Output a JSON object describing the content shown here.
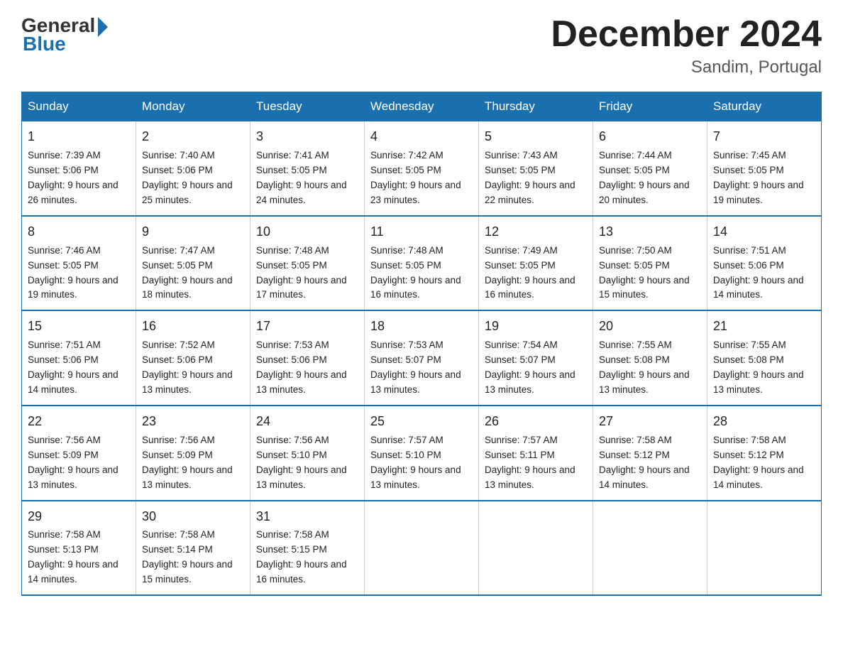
{
  "header": {
    "logo_general": "General",
    "logo_blue": "Blue",
    "month_title": "December 2024",
    "location": "Sandim, Portugal"
  },
  "days_of_week": [
    "Sunday",
    "Monday",
    "Tuesday",
    "Wednesday",
    "Thursday",
    "Friday",
    "Saturday"
  ],
  "weeks": [
    [
      {
        "day": "1",
        "sunrise": "7:39 AM",
        "sunset": "5:06 PM",
        "daylight": "9 hours and 26 minutes."
      },
      {
        "day": "2",
        "sunrise": "7:40 AM",
        "sunset": "5:06 PM",
        "daylight": "9 hours and 25 minutes."
      },
      {
        "day": "3",
        "sunrise": "7:41 AM",
        "sunset": "5:05 PM",
        "daylight": "9 hours and 24 minutes."
      },
      {
        "day": "4",
        "sunrise": "7:42 AM",
        "sunset": "5:05 PM",
        "daylight": "9 hours and 23 minutes."
      },
      {
        "day": "5",
        "sunrise": "7:43 AM",
        "sunset": "5:05 PM",
        "daylight": "9 hours and 22 minutes."
      },
      {
        "day": "6",
        "sunrise": "7:44 AM",
        "sunset": "5:05 PM",
        "daylight": "9 hours and 20 minutes."
      },
      {
        "day": "7",
        "sunrise": "7:45 AM",
        "sunset": "5:05 PM",
        "daylight": "9 hours and 19 minutes."
      }
    ],
    [
      {
        "day": "8",
        "sunrise": "7:46 AM",
        "sunset": "5:05 PM",
        "daylight": "9 hours and 19 minutes."
      },
      {
        "day": "9",
        "sunrise": "7:47 AM",
        "sunset": "5:05 PM",
        "daylight": "9 hours and 18 minutes."
      },
      {
        "day": "10",
        "sunrise": "7:48 AM",
        "sunset": "5:05 PM",
        "daylight": "9 hours and 17 minutes."
      },
      {
        "day": "11",
        "sunrise": "7:48 AM",
        "sunset": "5:05 PM",
        "daylight": "9 hours and 16 minutes."
      },
      {
        "day": "12",
        "sunrise": "7:49 AM",
        "sunset": "5:05 PM",
        "daylight": "9 hours and 16 minutes."
      },
      {
        "day": "13",
        "sunrise": "7:50 AM",
        "sunset": "5:05 PM",
        "daylight": "9 hours and 15 minutes."
      },
      {
        "day": "14",
        "sunrise": "7:51 AM",
        "sunset": "5:06 PM",
        "daylight": "9 hours and 14 minutes."
      }
    ],
    [
      {
        "day": "15",
        "sunrise": "7:51 AM",
        "sunset": "5:06 PM",
        "daylight": "9 hours and 14 minutes."
      },
      {
        "day": "16",
        "sunrise": "7:52 AM",
        "sunset": "5:06 PM",
        "daylight": "9 hours and 13 minutes."
      },
      {
        "day": "17",
        "sunrise": "7:53 AM",
        "sunset": "5:06 PM",
        "daylight": "9 hours and 13 minutes."
      },
      {
        "day": "18",
        "sunrise": "7:53 AM",
        "sunset": "5:07 PM",
        "daylight": "9 hours and 13 minutes."
      },
      {
        "day": "19",
        "sunrise": "7:54 AM",
        "sunset": "5:07 PM",
        "daylight": "9 hours and 13 minutes."
      },
      {
        "day": "20",
        "sunrise": "7:55 AM",
        "sunset": "5:08 PM",
        "daylight": "9 hours and 13 minutes."
      },
      {
        "day": "21",
        "sunrise": "7:55 AM",
        "sunset": "5:08 PM",
        "daylight": "9 hours and 13 minutes."
      }
    ],
    [
      {
        "day": "22",
        "sunrise": "7:56 AM",
        "sunset": "5:09 PM",
        "daylight": "9 hours and 13 minutes."
      },
      {
        "day": "23",
        "sunrise": "7:56 AM",
        "sunset": "5:09 PM",
        "daylight": "9 hours and 13 minutes."
      },
      {
        "day": "24",
        "sunrise": "7:56 AM",
        "sunset": "5:10 PM",
        "daylight": "9 hours and 13 minutes."
      },
      {
        "day": "25",
        "sunrise": "7:57 AM",
        "sunset": "5:10 PM",
        "daylight": "9 hours and 13 minutes."
      },
      {
        "day": "26",
        "sunrise": "7:57 AM",
        "sunset": "5:11 PM",
        "daylight": "9 hours and 13 minutes."
      },
      {
        "day": "27",
        "sunrise": "7:58 AM",
        "sunset": "5:12 PM",
        "daylight": "9 hours and 14 minutes."
      },
      {
        "day": "28",
        "sunrise": "7:58 AM",
        "sunset": "5:12 PM",
        "daylight": "9 hours and 14 minutes."
      }
    ],
    [
      {
        "day": "29",
        "sunrise": "7:58 AM",
        "sunset": "5:13 PM",
        "daylight": "9 hours and 14 minutes."
      },
      {
        "day": "30",
        "sunrise": "7:58 AM",
        "sunset": "5:14 PM",
        "daylight": "9 hours and 15 minutes."
      },
      {
        "day": "31",
        "sunrise": "7:58 AM",
        "sunset": "5:15 PM",
        "daylight": "9 hours and 16 minutes."
      },
      null,
      null,
      null,
      null
    ]
  ]
}
